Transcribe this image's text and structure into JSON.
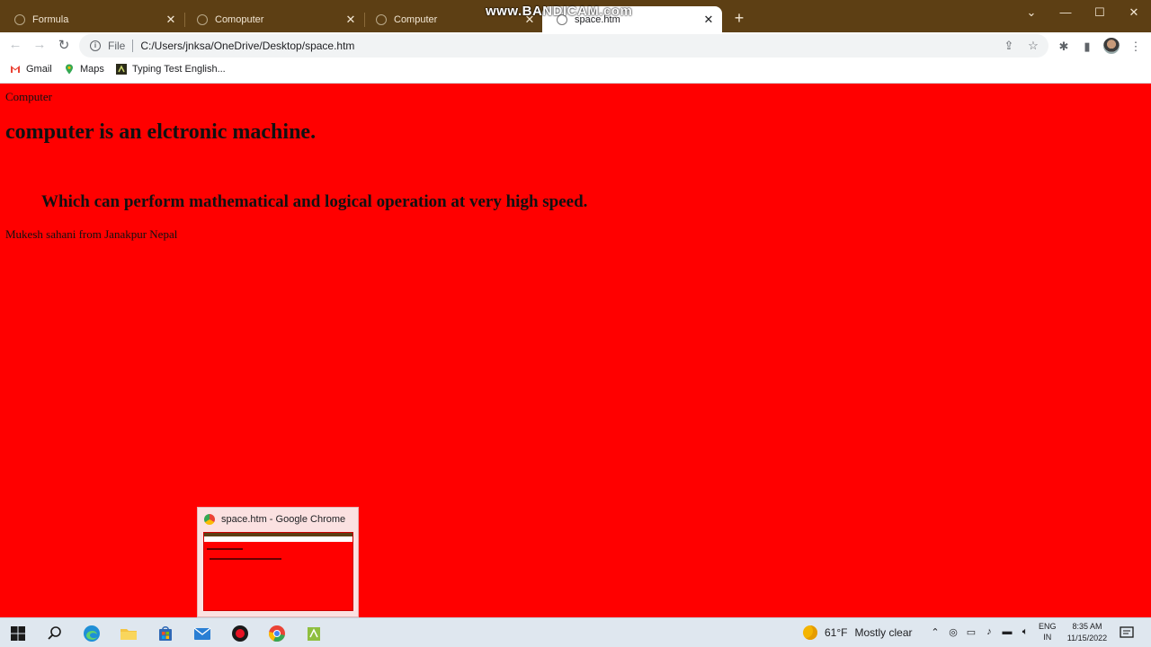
{
  "browser": {
    "tabs": [
      {
        "title": "Formula"
      },
      {
        "title": "Comoputer"
      },
      {
        "title": "Computer"
      },
      {
        "title": "space.htm"
      }
    ],
    "new_tab_symbol": "+",
    "watermark": "www.BANDICAM.com",
    "window_controls": {
      "minimize": "—",
      "maximize": "☐",
      "close": "✕",
      "tab_search": "⌄"
    },
    "address": {
      "scheme": "File",
      "url": "C:/Users/jnksa/OneDrive/Desktop/space.htm"
    },
    "bookmarks": [
      {
        "label": "Gmail",
        "icon": "gmail-icon"
      },
      {
        "label": "Maps",
        "icon": "maps-icon"
      },
      {
        "label": "Typing Test English...",
        "icon": "typing-test-icon"
      }
    ],
    "colors": {
      "tabbar": "#5d3f14",
      "page_bg": "#ff0000"
    }
  },
  "page": {
    "title_text": "Computer",
    "heading": "computer is an elctronic machine.",
    "subheading": "Which can perform mathematical and logical operation at very high speed.",
    "footer": "Mukesh sahani from Janakpur Nepal"
  },
  "taskbar": {
    "preview_title": "space.htm - Google Chrome",
    "weather": {
      "temp": "61°F",
      "condition": "Mostly clear"
    },
    "language": {
      "line1": "ENG",
      "line2": "IN"
    },
    "clock": {
      "time": "8:35 AM",
      "date": "11/15/2022"
    }
  }
}
